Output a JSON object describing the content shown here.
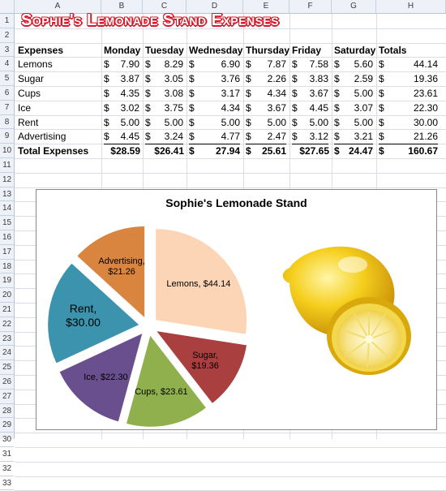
{
  "columns": [
    "A",
    "B",
    "C",
    "D",
    "E",
    "F",
    "G",
    "H"
  ],
  "rows": [
    "1",
    "2",
    "3",
    "4",
    "5",
    "6",
    "7",
    "8",
    "9",
    "10",
    "11",
    "12",
    "13",
    "14",
    "15",
    "16",
    "17",
    "18",
    "19",
    "20",
    "21",
    "22",
    "23",
    "24",
    "25",
    "26",
    "27",
    "28",
    "29",
    "30",
    "31",
    "32",
    "33"
  ],
  "sheet_title": "Sophie's Lemonade Stand Expenses",
  "table": {
    "headers": [
      "Expenses",
      "Monday",
      "Tuesday",
      "Wednesday",
      "Thursday",
      "Friday",
      "Saturday",
      "Totals"
    ],
    "currency": "$",
    "rows": [
      {
        "label": "Lemons",
        "values": [
          "7.90",
          "8.29",
          "6.90",
          "7.87",
          "7.58",
          "5.60"
        ],
        "total": "44.14"
      },
      {
        "label": "Sugar",
        "values": [
          "3.87",
          "3.05",
          "3.76",
          "2.26",
          "3.83",
          "2.59"
        ],
        "total": "19.36"
      },
      {
        "label": "Cups",
        "values": [
          "4.35",
          "3.08",
          "3.17",
          "4.34",
          "3.67",
          "5.00"
        ],
        "total": "23.61"
      },
      {
        "label": "Ice",
        "values": [
          "3.02",
          "3.75",
          "4.34",
          "3.67",
          "4.45",
          "3.07"
        ],
        "total": "22.30"
      },
      {
        "label": "Rent",
        "values": [
          "5.00",
          "5.00",
          "5.00",
          "5.00",
          "5.00",
          "5.00"
        ],
        "total": "30.00"
      },
      {
        "label": "Advertising",
        "values": [
          "4.45",
          "3.24",
          "4.77",
          "2.47",
          "3.12",
          "3.21"
        ],
        "total": "21.26"
      }
    ],
    "total_row": {
      "label": "Total Expenses",
      "values": [
        "$28.59",
        "$26.41",
        "27.94",
        "25.61",
        "$27.65",
        "24.47"
      ],
      "total": "160.67"
    }
  },
  "chart_data": {
    "type": "pie",
    "title": "Sophie's Lemonade Stand",
    "slices": [
      {
        "name": "Lemons",
        "value": 44.14,
        "label": "Lemons,  $44.14",
        "color": "#fbd5b5"
      },
      {
        "name": "Sugar",
        "value": 19.36,
        "label": "Sugar,\n$19.36",
        "color": "#a9403f"
      },
      {
        "name": "Cups",
        "value": 23.61,
        "label": "Cups,  $23.61",
        "color": "#8fb04c"
      },
      {
        "name": "Ice",
        "value": 22.3,
        "label": "Ice,  $22.30",
        "color": "#6a4f8e"
      },
      {
        "name": "Rent",
        "value": 30.0,
        "label": "Rent,\n$30.00",
        "color": "#3b93ad"
      },
      {
        "name": "Advertising",
        "value": 21.26,
        "label": "Advertising,\n$21.26",
        "color": "#d9843f"
      }
    ],
    "legend": "none"
  },
  "image": {
    "icon": "lemon-illustration"
  }
}
